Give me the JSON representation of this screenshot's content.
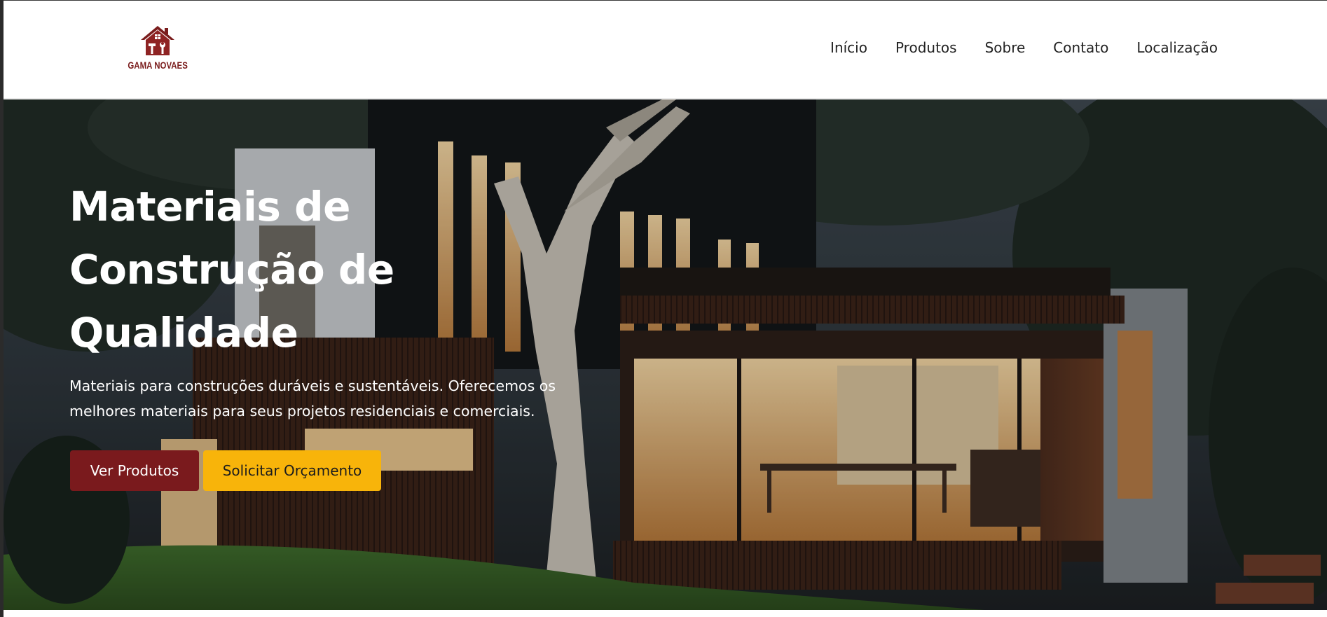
{
  "brand": {
    "name": "GAMA NOVAES",
    "color": "#7a1c1c"
  },
  "nav": {
    "items": [
      {
        "label": "Início"
      },
      {
        "label": "Produtos"
      },
      {
        "label": "Sobre"
      },
      {
        "label": "Contato"
      },
      {
        "label": "Localização"
      }
    ]
  },
  "hero": {
    "title": "Materiais de Construção de Qualidade",
    "subtitle": "Materiais para construções duráveis e sustentáveis. Oferecemos os melhores materiais para seus projetos residenciais e comerciais.",
    "primary_button": "Ver Produtos",
    "secondary_button": "Solicitar Orçamento",
    "background_image": "modern-house-at-dusk"
  },
  "colors": {
    "primary": "#7a1a1d",
    "accent": "#f8b40a",
    "nav_text": "#222222"
  }
}
